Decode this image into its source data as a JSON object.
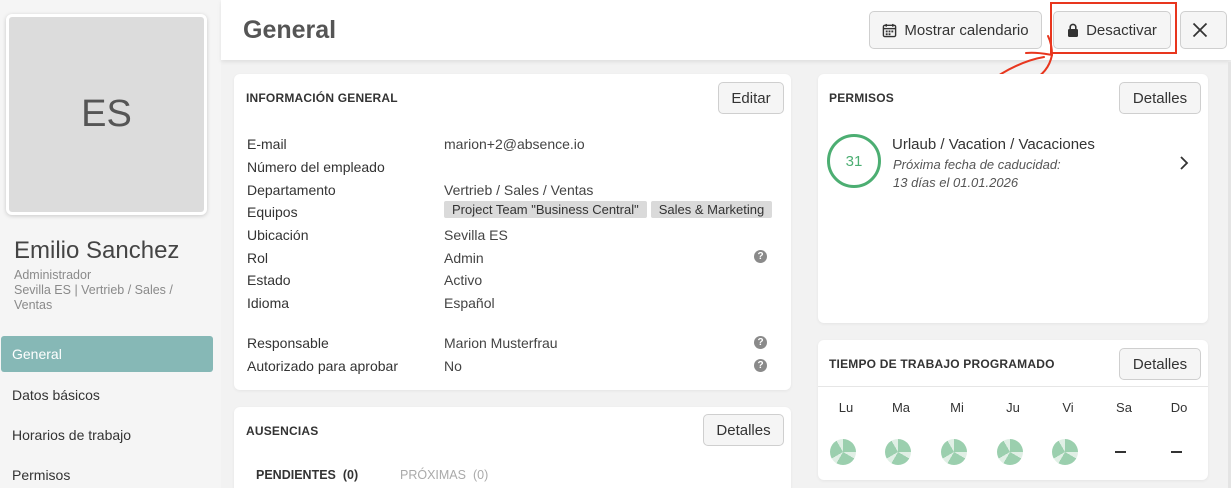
{
  "sidebar": {
    "avatar_initials": "ES",
    "name": "Emilio Sanchez",
    "role": "Administrador",
    "location": "Sevilla ES | Vertrieb / Sales / Ventas",
    "items": [
      {
        "label": "General",
        "active": true
      },
      {
        "label": "Datos básicos"
      },
      {
        "label": "Horarios de trabajo"
      },
      {
        "label": "Permisos"
      }
    ]
  },
  "header": {
    "title": "General",
    "calendar_button": "Mostrar calendario",
    "deactivate_button": "Desactivar"
  },
  "general_info": {
    "title": "INFORMACIÓN GENERAL",
    "edit_button": "Editar",
    "rows": [
      {
        "label": "E-mail",
        "value": "marion+2@absence.io"
      },
      {
        "label": "Número del empleado",
        "value": ""
      },
      {
        "label": "Departamento",
        "value": "Vertrieb / Sales / Ventas"
      },
      {
        "label": "Equipos",
        "tags": [
          "Project Team \"Business Central\"",
          "Sales & Marketing"
        ]
      },
      {
        "label": "Ubicación",
        "value": "Sevilla ES"
      },
      {
        "label": "Rol",
        "value": "Admin"
      },
      {
        "label": "Estado",
        "value": "Activo"
      },
      {
        "label": "Idioma",
        "value": "Español"
      },
      {
        "label": "Responsable",
        "value": "Marion Musterfrau"
      },
      {
        "label": "Autorizado para aprobar",
        "value": "No"
      }
    ]
  },
  "absences": {
    "title": "AUSENCIAS",
    "details_button": "Detalles",
    "tabs": [
      {
        "label": "PENDIENTES",
        "count": "(0)"
      },
      {
        "label": "PRÓXIMAS",
        "count": "(0)"
      }
    ]
  },
  "permissions": {
    "title": "PERMISOS",
    "details_button": "Detalles",
    "days": "31",
    "name": "Urlaub / Vacation / Vacaciones",
    "expiry_label": "Próxima fecha de caducidad:",
    "expiry_value": "13 días el 01.01.2026"
  },
  "schedule": {
    "title": "TIEMPO DE TRABAJO PROGRAMADO",
    "details_button": "Detalles",
    "days": [
      "Lu",
      "Ma",
      "Mi",
      "Ju",
      "Vi",
      "Sa",
      "Do"
    ]
  },
  "colors": {
    "accent": "#86b8b6",
    "ring": "#4cae72",
    "annotation": "#e8361e"
  }
}
